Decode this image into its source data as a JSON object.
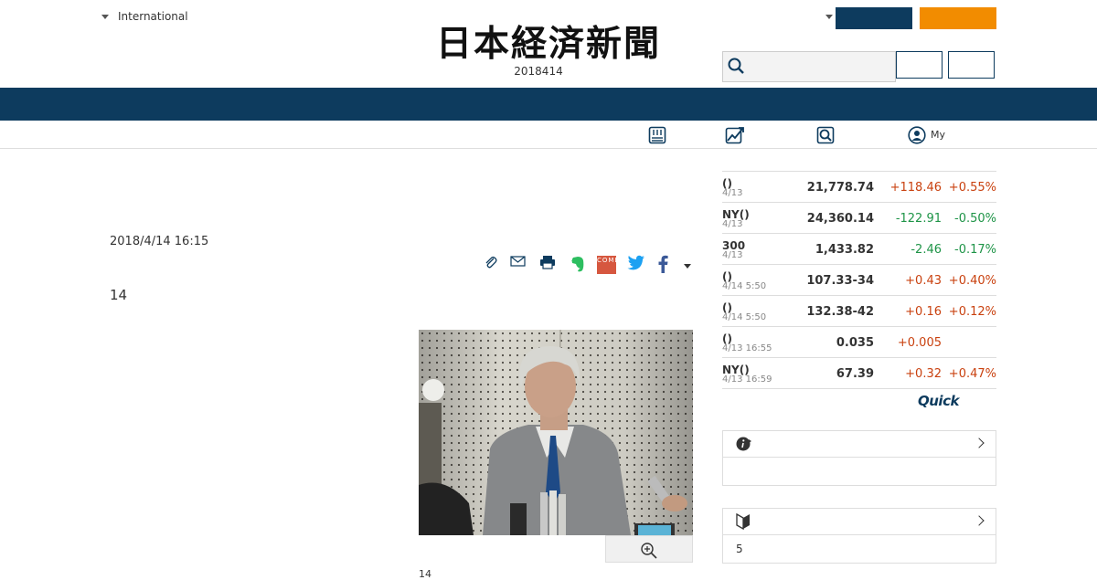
{
  "header": {
    "edition_label": "International",
    "logo_text": "日本経済新聞",
    "date_text": "2018414",
    "btn_blue_label": "",
    "btn_orange_label": "",
    "login_label": "",
    "signup_label": "",
    "search_placeholder": ""
  },
  "subnav": {
    "my_label": "My"
  },
  "article": {
    "date": "2018/4/14 16:15",
    "lead_number": "14",
    "caption": "14",
    "share_icons": [
      "clip-icon",
      "mail-icon",
      "print-icon",
      "evernote-icon",
      "come-icon",
      "twitter-icon",
      "facebook-icon",
      "more-dropdown-icon"
    ],
    "come_text": "COME"
  },
  "market": {
    "rows": [
      {
        "name": "()",
        "time": "4/13",
        "value": "21,778.74",
        "change": "+118.46",
        "pct": "+0.55%",
        "dir": "up"
      },
      {
        "name": "NY()",
        "time": "4/13",
        "value": "24,360.14",
        "change": "-122.91",
        "pct": "-0.50%",
        "dir": "down"
      },
      {
        "name": "300",
        "time": "4/13",
        "value": "1,433.82",
        "change": "-2.46",
        "pct": "-0.17%",
        "dir": "down"
      },
      {
        "name": "()",
        "time": "4/14 5:50",
        "value": "107.33-34",
        "change": "+0.43",
        "pct": "+0.40%",
        "dir": "up"
      },
      {
        "name": "()",
        "time": "4/14 5:50",
        "value": "132.38-42",
        "change": "+0.16",
        "pct": "+0.12%",
        "dir": "up"
      },
      {
        "name": "()",
        "time": "4/13 16:55",
        "value": "0.035",
        "change": "+0.005",
        "pct": "",
        "dir": "up"
      },
      {
        "name": "NY()",
        "time": "4/13 16:59",
        "value": "67.39",
        "change": "+0.32",
        "pct": "+0.47%",
        "dir": "up"
      }
    ],
    "quick_logo": "Quick"
  },
  "panels": {
    "info_count": "",
    "beginner_count": "5"
  },
  "colors": {
    "navy": "#0d3b5e",
    "orange": "#f28c00",
    "up": "#c9410f",
    "down": "#1e9447"
  }
}
